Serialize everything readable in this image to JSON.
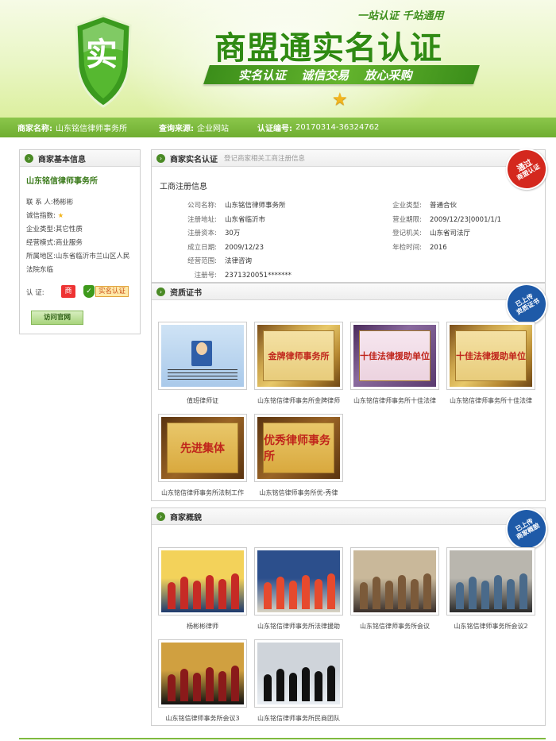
{
  "header": {
    "shield_char": "实",
    "slogan_top": "一站认证  千站通用",
    "title": "商盟通实名认证",
    "ribbon": "实名认证  诚信交易  放心采购"
  },
  "infobar": {
    "name_label": "商家名称:",
    "name_value": "山东铭信律师事务所",
    "source_label": "查询来源:",
    "source_value": "企业网站",
    "code_label": "认证编号:",
    "code_value": "20170314-36324762"
  },
  "left_panel": {
    "title": "商家基本信息",
    "company": "山东铭信律师事务所",
    "contact": "联 系 人:杨彬彬",
    "credit_label": "诚信指数:",
    "type": "企业类型:其它性质",
    "mode": "经营模式:商业服务",
    "region_line1": "所属地区:山东省临沂市兰山区人民",
    "region_line2": "法院东临",
    "cert_label": "认    证:",
    "cert_badge1": "商",
    "cert_badge2": "实名认证",
    "visit_button": "访问官网"
  },
  "reg_panel": {
    "title": "商家实名认证",
    "subtitle": "登记商家相关工商注册信息",
    "corner_line1": "通过",
    "corner_line2": "商盟认证",
    "section": "工商注册信息",
    "fields_left": [
      {
        "k": "公司名称:",
        "v": "山东铭信律师事务所"
      },
      {
        "k": "注册地址:",
        "v": "山东省临沂市"
      },
      {
        "k": "注册资本:",
        "v": "30万"
      },
      {
        "k": "成立日期:",
        "v": "2009/12/23"
      },
      {
        "k": "经营范围:",
        "v": "法律咨询"
      },
      {
        "k": "注册号:",
        "v": "2371320051*******"
      }
    ],
    "fields_right": [
      {
        "k": "企业类型:",
        "v": "普通合伙"
      },
      {
        "k": "营业期限:",
        "v": "2009/12/23|0001/1/1"
      },
      {
        "k": "登记机关:",
        "v": "山东省司法厅"
      },
      {
        "k": "年检时间:",
        "v": "2016"
      }
    ]
  },
  "cert_panel": {
    "title": "资质证书",
    "corner_line1": "已上传",
    "corner_line2": "资质证书",
    "items": [
      {
        "caption": "值班律师证",
        "plaque": ""
      },
      {
        "caption": "山东铭信律师事务所金牌律师",
        "plaque": "金牌律师事务所"
      },
      {
        "caption": "山东铭信律师事务所十佳法律",
        "plaque": "十佳法律援助单位"
      },
      {
        "caption": "山东铭信律师事务所十佳法律",
        "plaque": "十佳法律援助单位"
      },
      {
        "caption": "山东铭信律师事务所法制工作",
        "plaque": "先进集体"
      },
      {
        "caption": "山东铭信律师事务所优-秀律",
        "plaque": "优秀律师事务所"
      }
    ]
  },
  "overview_panel": {
    "title": "商家概貌",
    "corner_line1": "已上传",
    "corner_line2": "商家概貌",
    "items": [
      {
        "caption": "杨彬彬律师"
      },
      {
        "caption": "山东铭信律师事务所法律援助"
      },
      {
        "caption": "山东铭信律师事务所会议"
      },
      {
        "caption": "山东铭信律师事务所会议2"
      },
      {
        "caption": "山东铭信律师事务所会议3"
      },
      {
        "caption": "山东铭信律师事务所民商团队"
      }
    ]
  },
  "colors": {
    "brand_green": "#2f8a12",
    "bar_green": "#7fba3f",
    "badge_red": "#d4281e",
    "badge_blue": "#1e5aa8"
  }
}
